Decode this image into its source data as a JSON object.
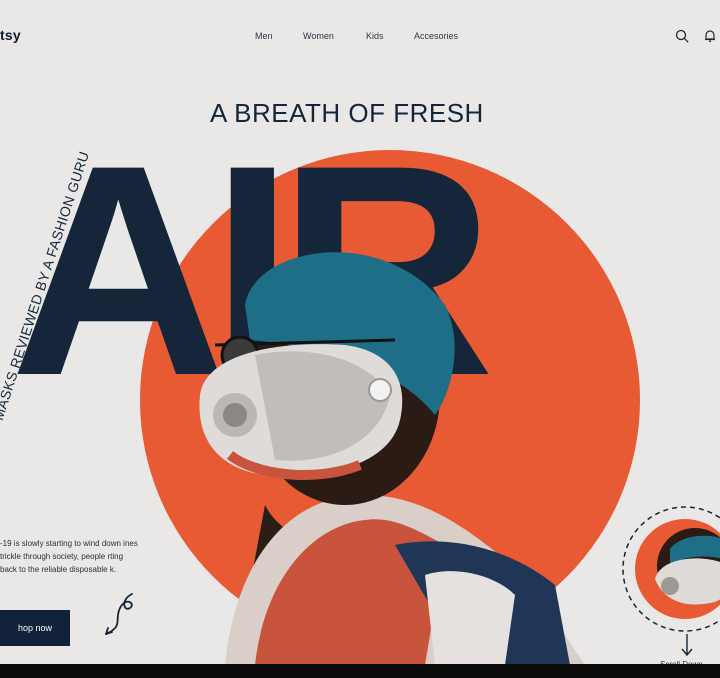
{
  "brand": {
    "logo": "tsy"
  },
  "nav": {
    "items": [
      {
        "label": "Men"
      },
      {
        "label": "Women"
      },
      {
        "label": "Kids"
      },
      {
        "label": "Accesories"
      }
    ],
    "search_icon": "search-icon",
    "notification_icon": "bell-icon"
  },
  "hero": {
    "subtitle": "A BREATH OF FRESH",
    "headline": "AIR",
    "side_text": "MASKS REVIEWED BY A FASHION GURU",
    "description": "-19 is slowly starting to wind down ines trickle through society, people rting back to the reliable disposable k.",
    "cta_label": "hop now",
    "scroll_label": "Scroll Down"
  },
  "colors": {
    "background": "#e9e8e6",
    "navy": "#15263a",
    "accent_orange": "#e85a33"
  }
}
